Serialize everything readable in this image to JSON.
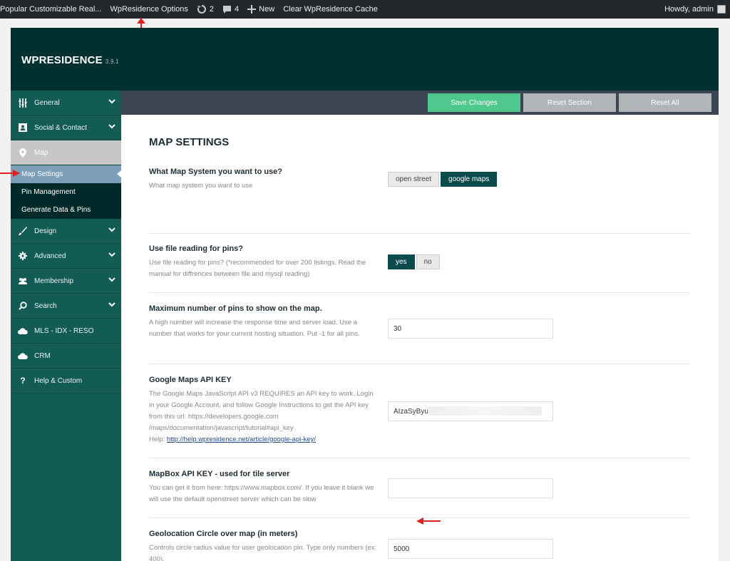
{
  "adminbar": {
    "site_name": "Popular Customizable Real...",
    "options_link": "WpResidence Options",
    "updates_count": "2",
    "comments_count": "4",
    "new_label": "New",
    "clear_cache": "Clear WpResidence Cache",
    "greeting": "Howdy, admin"
  },
  "brand": {
    "name": "WPRESIDENCE",
    "version": "3.9.1"
  },
  "sidebar": {
    "items": [
      {
        "label": "General",
        "icon": "sliders-icon"
      },
      {
        "label": "Social & Contact",
        "icon": "contact-card-icon"
      },
      {
        "label": "Map",
        "icon": "map-pin-icon"
      },
      {
        "label": "Design",
        "icon": "brush-icon"
      },
      {
        "label": "Advanced",
        "icon": "gear-icon"
      },
      {
        "label": "Membership",
        "icon": "users-icon"
      },
      {
        "label": "Search",
        "icon": "search-icon"
      },
      {
        "label": "MLS - IDX - RESO",
        "icon": "cloud-icon"
      },
      {
        "label": "CRM",
        "icon": "cloud-icon"
      },
      {
        "label": "Help & Custom",
        "icon": "question-icon"
      }
    ],
    "map_sub": [
      "Map Settings",
      "Pin Management",
      "Generate Data & Pins"
    ]
  },
  "toolbar": {
    "save": "Save Changes",
    "reset_section": "Reset Section",
    "reset_all": "Reset All"
  },
  "main": {
    "title": "MAP SETTINGS",
    "map_system": {
      "label": "What Map System you want to use?",
      "desc": "What map system you want to use",
      "options": [
        "open street",
        "google maps"
      ],
      "selected": "google maps"
    },
    "file_reading": {
      "label": "Use file reading for pins?",
      "desc": "Use file reading for pins? (*recommended for over 200 listings. Read the manual for diffrences between file and mysql reading)",
      "options": [
        "yes",
        "no"
      ],
      "selected": "yes"
    },
    "max_pins": {
      "label": "Maximum number of pins to show on the map.",
      "desc": "A high number will increase the response time and server load. Use a number that works for your current hosting situation. Put -1 for all pins.",
      "value": "30"
    },
    "google_key": {
      "label": "Google Maps API KEY",
      "desc": "The Google Maps JavaScript API v3 REQUIRES an API key to work. Login in your Google Account, and follow Google Instructions to get the API key from this url: https://developers.google.com /maps/documentation/javascript/tutorial#api_key",
      "help_prefix": "Help: ",
      "help_link": "http://help.wpresidence.net/article/google-api-key/",
      "value": "AIzaSyByu_                                          GA"
    },
    "mapbox_key": {
      "label": "MapBox API KEY - used for tile server",
      "desc": "You can get it from here: https://www.mapbox.com/. If you leave it blank we will use the default openstreet server which can be slow",
      "value": ""
    },
    "geolocation": {
      "label": "Geolocation Circle over map (in meters)",
      "desc": "Controls circle radius value for user geolocation pin. Type only numbers (ex: 400).",
      "value": "5000"
    }
  },
  "colors": {
    "header": "#00302f",
    "sidebar": "#135b55",
    "accent": "#4ec88c",
    "annotation": "#e02020"
  }
}
